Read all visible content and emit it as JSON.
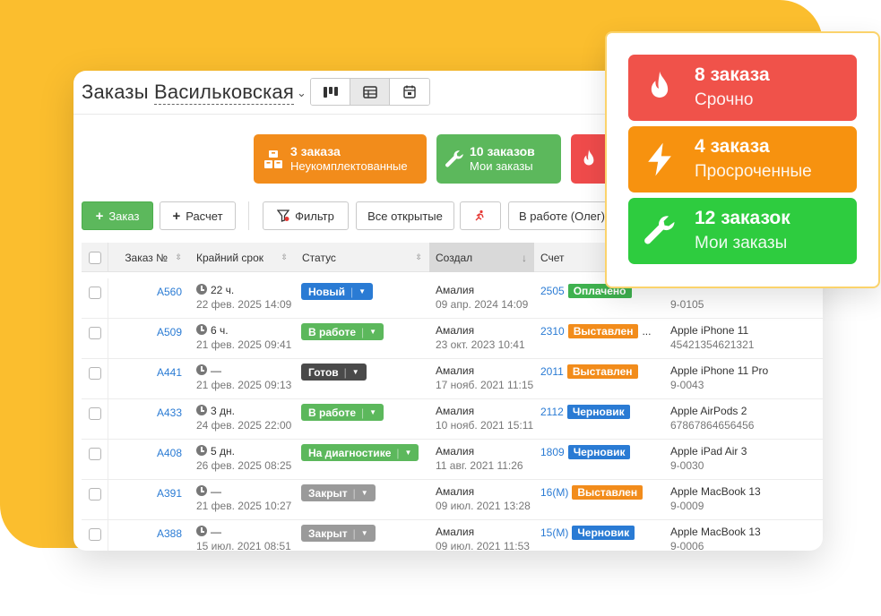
{
  "header": {
    "title": "Заказы",
    "branch": "Васильковская",
    "caret": "⌄"
  },
  "tiles": [
    {
      "count": "3 заказа",
      "label": "Неукомплектованные",
      "color": "#f28c1b",
      "icon": "boxes-icon"
    },
    {
      "count": "10 заказов",
      "label": "Мои заказы",
      "color": "#5cb85c",
      "icon": "wrench-icon"
    },
    {
      "count": "",
      "label": "",
      "color": "#ef4b4b",
      "icon": "fire-icon"
    }
  ],
  "toolbar": {
    "add_order": "Заказ",
    "calc": "Расчет",
    "filter": "Фильтр",
    "all_open": "Все открытые",
    "in_work": "В работе (Олег)"
  },
  "table": {
    "columns": [
      "Заказ №",
      "Крайний срок",
      "Статус",
      "Создал",
      "Счет"
    ],
    "rows": [
      {
        "id": "A560",
        "deadline": "22 ч.",
        "deadline_date": "22 фев. 2025 14:09",
        "status": "Новый",
        "status_color": "#2a7bd4",
        "created_by": "Амалия",
        "created_at": "09 апр. 2024 14:09",
        "invoice": "2505",
        "invoice_status": "Оплачено",
        "invoice_color": "#3fb24f",
        "device": "",
        "serial": "9-0105"
      },
      {
        "id": "A509",
        "deadline": "6 ч.",
        "deadline_date": "21 фев. 2025 09:41",
        "status": "В работе",
        "status_color": "#5cb85c",
        "created_by": "Амалия",
        "created_at": "23 окт. 2023 10:41",
        "invoice": "2310",
        "invoice_status": "Выставлен",
        "invoice_color": "#f28c1b",
        "invoice_more": "...",
        "device": "Apple iPhone 11",
        "serial": "45421354621321"
      },
      {
        "id": "A441",
        "deadline": "—",
        "deadline_date": "21 фев. 2025 09:13",
        "status": "Готов",
        "status_color": "#4a4a4a",
        "created_by": "Амалия",
        "created_at": "17 нояб. 2021 11:15",
        "invoice": "2011",
        "invoice_status": "Выставлен",
        "invoice_color": "#f28c1b",
        "device": "Apple iPhone 11 Pro",
        "serial": "9-0043"
      },
      {
        "id": "A433",
        "deadline": "3 дн.",
        "deadline_date": "24 фев. 2025 22:00",
        "status": "В работе",
        "status_color": "#5cb85c",
        "created_by": "Амалия",
        "created_at": "10 нояб. 2021 15:11",
        "invoice": "2112",
        "invoice_status": "Черновик",
        "invoice_color": "#2a7bd4",
        "device": "Apple AirPods 2",
        "serial": "67867864656456"
      },
      {
        "id": "A408",
        "deadline": "5 дн.",
        "deadline_date": "26 фев. 2025 08:25",
        "status": "На диагностике",
        "status_color": "#5cb85c",
        "created_by": "Амалия",
        "created_at": "11 авг. 2021 11:26",
        "invoice": "1809",
        "invoice_status": "Черновик",
        "invoice_color": "#2a7bd4",
        "device": "Apple iPad Air 3",
        "serial": "9-0030"
      },
      {
        "id": "A391",
        "deadline": "—",
        "deadline_date": "21 фев. 2025 10:27",
        "status": "Закрыт",
        "status_color": "#9a9a9a",
        "created_by": "Амалия",
        "created_at": "09 июл. 2021 13:28",
        "invoice": "16(M)",
        "invoice_status": "Выставлен",
        "invoice_color": "#f28c1b",
        "device": "Apple MacBook 13",
        "serial": "9-0009"
      },
      {
        "id": "A388",
        "deadline": "—",
        "deadline_date": "15 июл. 2021 08:51",
        "status": "Закрыт",
        "status_color": "#9a9a9a",
        "created_by": "Амалия",
        "created_at": "09 июл. 2021 11:53",
        "invoice": "15(M)",
        "invoice_status": "Черновик",
        "invoice_color": "#2a7bd4",
        "device": "Apple MacBook 13",
        "serial": "9-0006"
      }
    ]
  },
  "overlay": [
    {
      "count": "8 заказа",
      "label": "Срочно",
      "color": "#f0524a",
      "icon": "fire-icon"
    },
    {
      "count": "4 заказа",
      "label": "Просроченные",
      "color": "#f7920f",
      "icon": "lightning-icon"
    },
    {
      "count": "12 заказок",
      "label": "Мои заказы",
      "color": "#2ecc3f",
      "icon": "wrench-icon"
    }
  ]
}
